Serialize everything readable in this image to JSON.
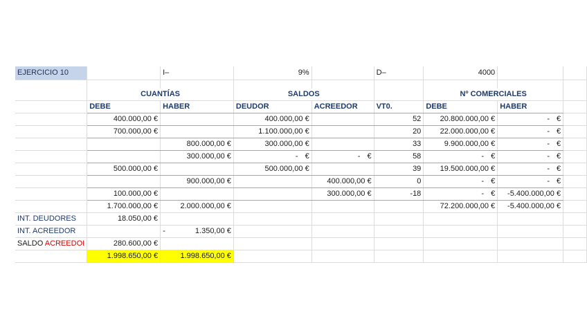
{
  "header": {
    "title": "EJERCICIO 10",
    "i_label": "I–",
    "i_value": "9%",
    "d_label": "D–",
    "d_value": "4000"
  },
  "groups": {
    "cuantias": "CUANTÍAS",
    "saldos": "SALDOS",
    "comerciales": "Nº COMERCIALES"
  },
  "columns": {
    "debe": "DEBE",
    "haber": "HABER",
    "deudor": "DEUDOR",
    "acreedor": "ACREEDOR",
    "vto": "VT0.",
    "nc_debe": "DEBE",
    "nc_haber": "HABER"
  },
  "rows": [
    {
      "debe": "400.000,00 €",
      "haber": "",
      "deudor": "400.000,00 €",
      "acreedor": "",
      "vto": "52",
      "nc_debe": "20.800.000,00 €",
      "nc_haber": "-"
    },
    {
      "debe": "700.000,00 €",
      "haber": "",
      "deudor": "1.100.000,00 €",
      "acreedor": "",
      "vto": "20",
      "nc_debe": "22.000.000,00 €",
      "nc_haber": "-"
    },
    {
      "debe": "",
      "haber": "800.000,00 €",
      "deudor": "300.000,00 €",
      "acreedor": "",
      "vto": "33",
      "nc_debe": "9.900.000,00 €",
      "nc_haber": "-"
    },
    {
      "debe": "",
      "haber": "300.000,00 €",
      "deudor": "-",
      "acreedor": "-",
      "vto": "58",
      "nc_debe": "-",
      "nc_haber": "-"
    },
    {
      "debe": "500.000,00 €",
      "haber": "",
      "deudor": "500.000,00 €",
      "acreedor": "",
      "vto": "39",
      "nc_debe": "19.500.000,00 €",
      "nc_haber": "-"
    },
    {
      "debe": "",
      "haber": "900.000,00 €",
      "deudor": "",
      "acreedor": "400.000,00 €",
      "vto": "0",
      "nc_debe": "-",
      "nc_haber": "-"
    },
    {
      "debe": "100.000,00 €",
      "haber": "",
      "deudor": "",
      "acreedor": "300.000,00 €",
      "vto": "-18",
      "nc_debe": "-",
      "nc_haber": "-5.400.000,00 €"
    }
  ],
  "euro": "€",
  "totals": {
    "debe": "1.700.000,00 €",
    "haber": "2.000.000,00 €",
    "nc_debe": "72.200.000,00 €",
    "nc_haber": "-5.400.000,00 €"
  },
  "int_deudores": {
    "label": "INT. DEUDORES",
    "value": "18.050,00 €"
  },
  "int_acreedor": {
    "label": "INT. ACREEDOR",
    "dash": "-",
    "value": "1.350,00 €"
  },
  "saldo": {
    "label_black": "SALDO",
    "label_red": "ACREEDOI",
    "value": "280.600,00 €"
  },
  "final": {
    "debe": "1.998.650,00 €",
    "haber": "1.998.650,00 €"
  },
  "colors": {
    "title_bg": "#c6d4ea",
    "highlight": "#ffff00",
    "header_text": "#1f3a6b",
    "red": "#e00000"
  }
}
